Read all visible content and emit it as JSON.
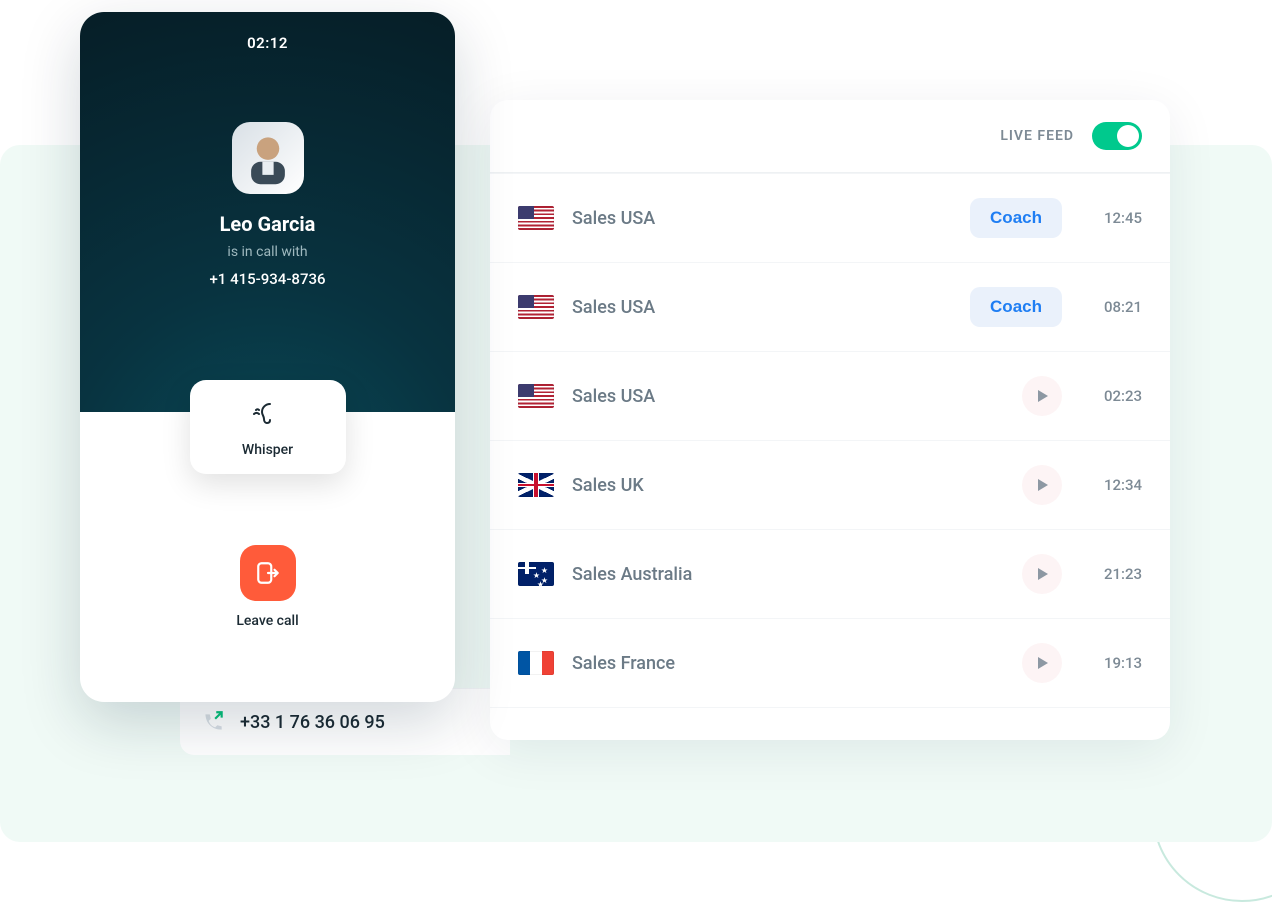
{
  "phone": {
    "timer": "02:12",
    "caller_name": "Leo Garcia",
    "status_line": "is in call with",
    "caller_number": "+1 415-934-8736",
    "whisper_label": "Whisper",
    "leave_label": "Leave call"
  },
  "feed": {
    "label": "LIVE FEED",
    "toggle_on": true,
    "rows": [
      {
        "flag": "usa",
        "label": "Sales USA",
        "action": "coach",
        "action_label": "Coach",
        "time": "12:45"
      },
      {
        "flag": "usa",
        "label": "Sales USA",
        "action": "coach",
        "action_label": "Coach",
        "time": "08:21"
      },
      {
        "flag": "usa",
        "label": "Sales USA",
        "action": "play",
        "time": "02:23"
      },
      {
        "flag": "uk",
        "label": "Sales UK",
        "action": "play",
        "time": "12:34"
      },
      {
        "flag": "au",
        "label": "Sales Australia",
        "action": "play",
        "time": "21:23"
      },
      {
        "flag": "fr",
        "label": "Sales France",
        "action": "play",
        "time": "19:13"
      }
    ]
  },
  "outbound": {
    "number": "+33 1 76 36 06 95"
  }
}
